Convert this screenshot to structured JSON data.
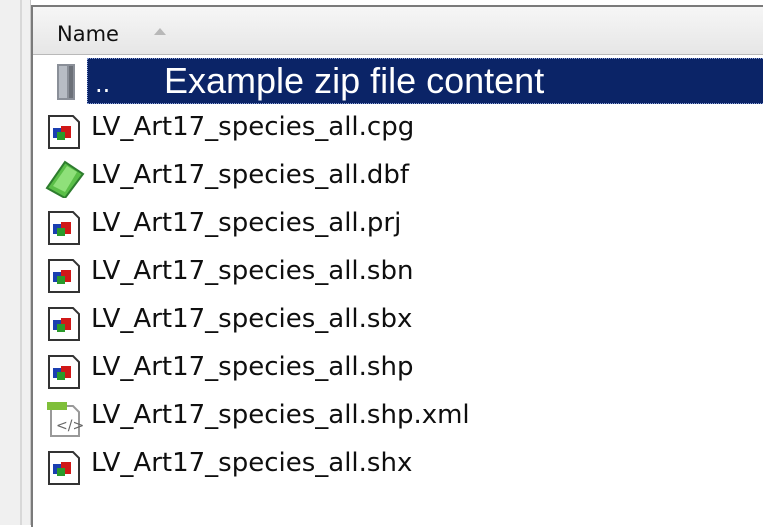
{
  "header": {
    "name_label": "Name"
  },
  "parent_row": {
    "label": "..",
    "caption": "Example zip file content"
  },
  "files": [
    {
      "label": "LV_Art17_species_all.cpg",
      "icon": "generic-file-icon"
    },
    {
      "label": "LV_Art17_species_all.dbf",
      "icon": "database-file-icon"
    },
    {
      "label": "LV_Art17_species_all.prj",
      "icon": "generic-file-icon"
    },
    {
      "label": "LV_Art17_species_all.sbn",
      "icon": "generic-file-icon"
    },
    {
      "label": "LV_Art17_species_all.sbx",
      "icon": "generic-file-icon"
    },
    {
      "label": "LV_Art17_species_all.shp",
      "icon": "generic-file-icon"
    },
    {
      "label": "LV_Art17_species_all.shp.xml",
      "icon": "xml-file-icon"
    },
    {
      "label": "LV_Art17_species_all.shx",
      "icon": "generic-file-icon"
    }
  ],
  "colors": {
    "selection": "#0b2467",
    "header_bg": "#eeeeee"
  }
}
